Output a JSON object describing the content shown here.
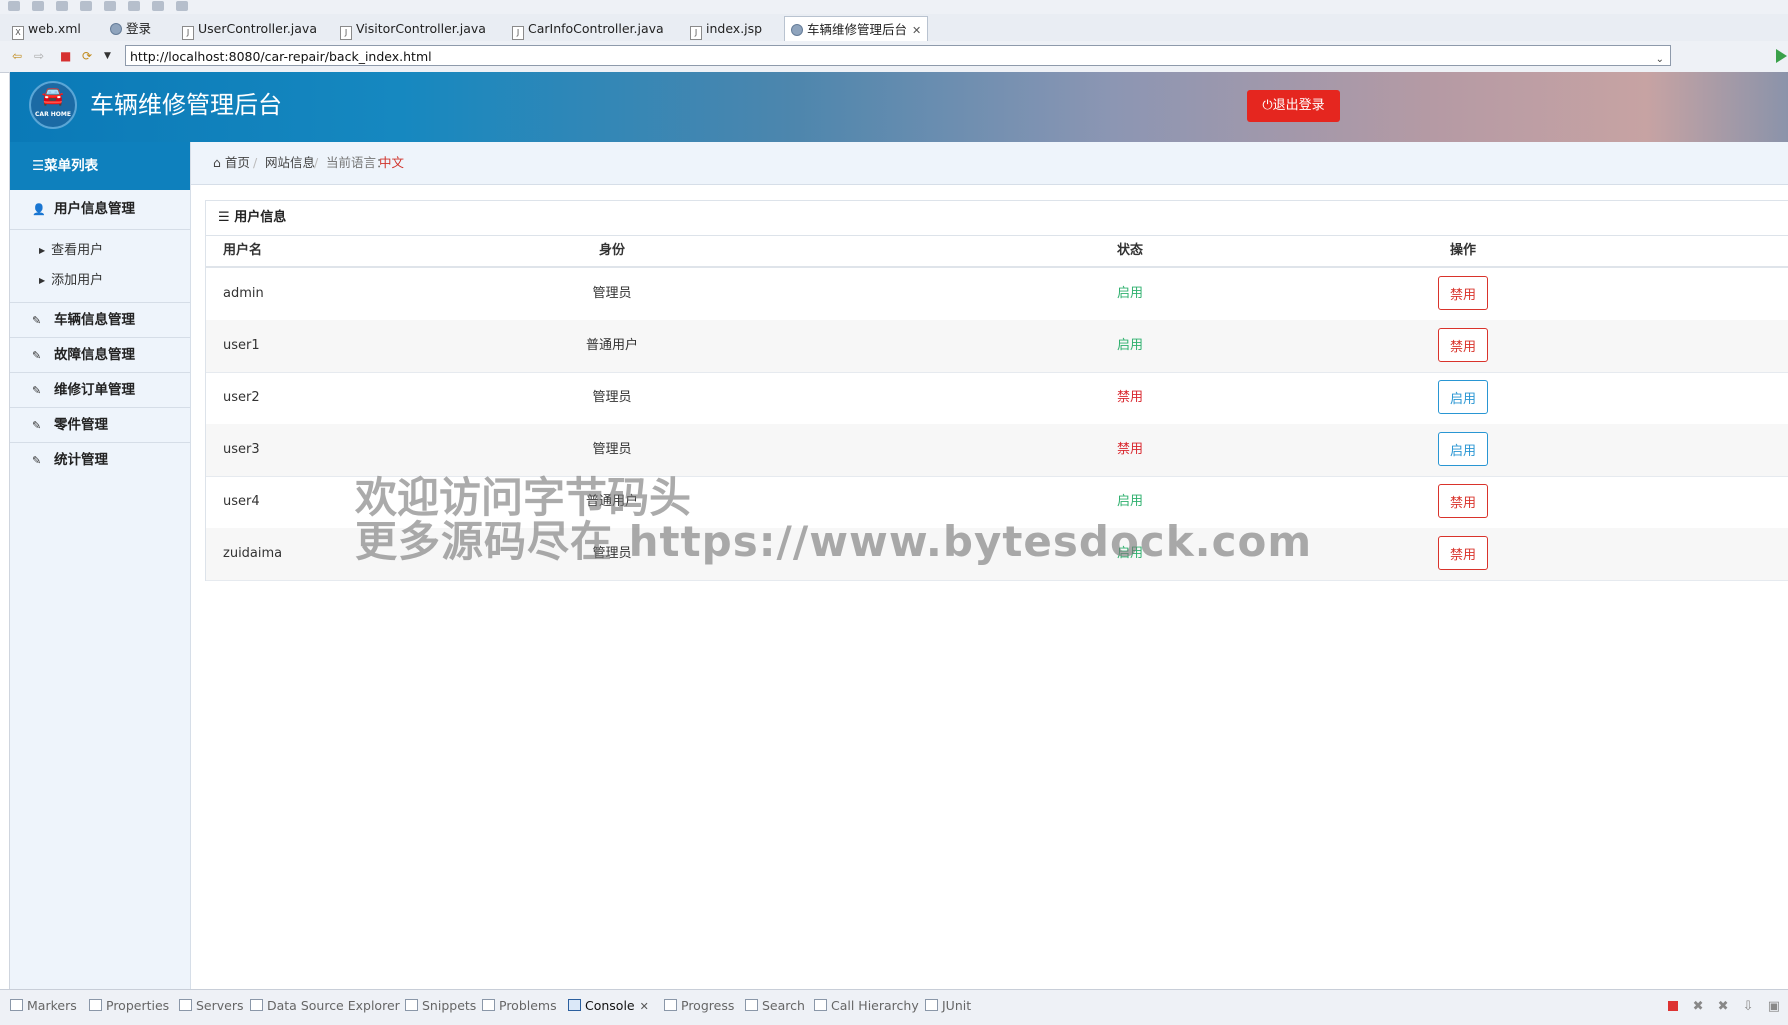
{
  "editor_tabs": [
    {
      "label": "web.xml",
      "icon": "xml-file-icon"
    },
    {
      "label": "登录",
      "icon": "browser-globe-icon"
    },
    {
      "label": "UserController.java",
      "icon": "java-file-icon"
    },
    {
      "label": "VisitorController.java",
      "icon": "java-file-icon"
    },
    {
      "label": "CarInfoController.java",
      "icon": "java-file-icon"
    },
    {
      "label": "index.jsp",
      "icon": "jsp-file-icon"
    },
    {
      "label": "车辆维修管理后台",
      "icon": "browser-globe-icon",
      "active": true
    }
  ],
  "address_bar": {
    "url": "http://localhost:8080/car-repair/back_index.html"
  },
  "header": {
    "title": "车辆维修管理后台",
    "logo_text": "CAR HOME",
    "logout_label": "退出登录",
    "logout_color": "#e5261f"
  },
  "sidebar": {
    "head": "菜单列表",
    "items": [
      {
        "label": "用户信息管理",
        "icon": "user-icon"
      },
      {
        "label": "车辆信息管理",
        "icon": "edit-icon"
      },
      {
        "label": "故障信息管理",
        "icon": "edit-icon"
      },
      {
        "label": "维修订单管理",
        "icon": "edit-icon"
      },
      {
        "label": "零件管理",
        "icon": "edit-icon"
      },
      {
        "label": "统计管理",
        "icon": "edit-icon"
      }
    ],
    "sub_items": [
      {
        "label": "查看用户"
      },
      {
        "label": "添加用户"
      }
    ]
  },
  "breadcrumb": {
    "home": "首页",
    "site_info": "网站信息",
    "lang_label": "当前语言：",
    "lang_value": "中文"
  },
  "panel": {
    "title": "用户信息",
    "columns": [
      "用户名",
      "身份",
      "状态",
      "操作"
    ],
    "rows": [
      {
        "username": "admin",
        "role": "管理员",
        "status": "启用",
        "status_type": "enabled",
        "action": "禁用",
        "action_type": "danger"
      },
      {
        "username": "user1",
        "role": "普通用户",
        "status": "启用",
        "status_type": "enabled",
        "action": "禁用",
        "action_type": "danger"
      },
      {
        "username": "user2",
        "role": "管理员",
        "status": "禁用",
        "status_type": "disabled",
        "action": "启用",
        "action_type": "primary"
      },
      {
        "username": "user3",
        "role": "管理员",
        "status": "禁用",
        "status_type": "disabled",
        "action": "启用",
        "action_type": "primary"
      },
      {
        "username": "user4",
        "role": "普通用户",
        "status": "启用",
        "status_type": "enabled",
        "action": "禁用",
        "action_type": "danger"
      },
      {
        "username": "zuidaima",
        "role": "管理员",
        "status": "启用",
        "status_type": "enabled",
        "action": "禁用",
        "action_type": "danger"
      }
    ]
  },
  "watermark": {
    "line1": "欢迎访问字节码头",
    "line2": "更多源码尽在 https://www.bytesdock.com"
  },
  "bottom_views": [
    {
      "label": "Markers"
    },
    {
      "label": "Properties"
    },
    {
      "label": "Servers"
    },
    {
      "label": "Data Source Explorer"
    },
    {
      "label": "Snippets"
    },
    {
      "label": "Problems"
    },
    {
      "label": "Console",
      "active": true
    },
    {
      "label": "Progress"
    },
    {
      "label": "Search"
    },
    {
      "label": "Call Hierarchy"
    },
    {
      "label": "JUnit"
    }
  ],
  "colors": {
    "status_enabled": "#2fb06e",
    "status_disabled": "#d9272e",
    "sidebar_head": "#0e80bd"
  }
}
